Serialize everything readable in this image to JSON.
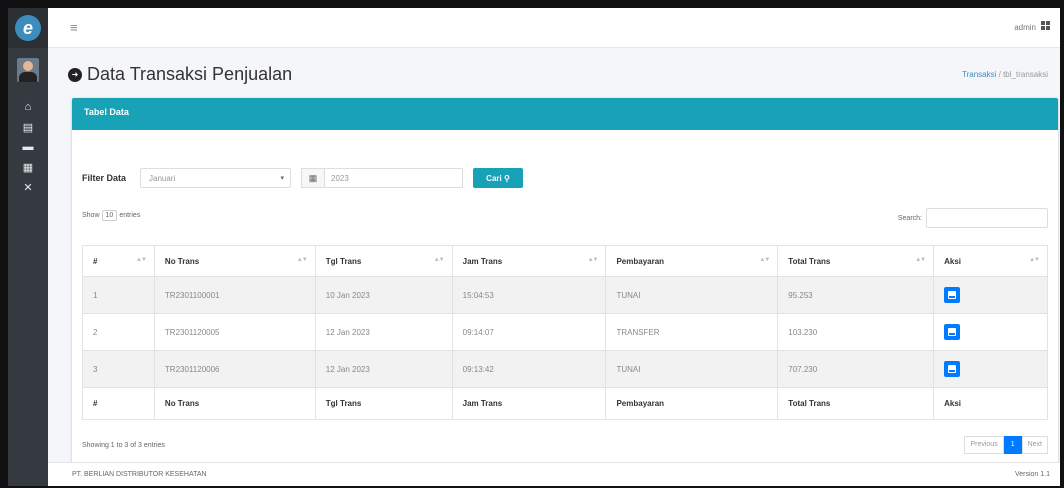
{
  "sidebar": {
    "logo_letter": "e",
    "icons": [
      "home-icon",
      "book-icon",
      "wallet-icon",
      "calculator-icon",
      "tools-icon"
    ],
    "icon_glyphs": [
      "⌂",
      "▤",
      "▬",
      "▦",
      "✕"
    ]
  },
  "topbar": {
    "menu_glyph": "≡",
    "user": "admin"
  },
  "page": {
    "title": "Data Transaksi Penjualan",
    "breadcrumb_link": "Transaksi",
    "breadcrumb_sep": "/",
    "breadcrumb_current": "tbl_transaksi"
  },
  "card": {
    "header": "Tabel Data",
    "filter_label": "Filter Data",
    "month_value": "Januari",
    "year_value": "2023",
    "search_button": "Cari",
    "show_prefix": "Show",
    "show_value": "10",
    "show_suffix": "entries",
    "search_label": "Search:"
  },
  "table": {
    "columns": [
      "#",
      "No Trans",
      "Tgl Trans",
      "Jam Trans",
      "Pembayaran",
      "Total Trans",
      "Aksi"
    ],
    "rows": [
      [
        "1",
        "TR2301100001",
        "10 Jan 2023",
        "15:04:53",
        "TUNAI",
        "95.253"
      ],
      [
        "2",
        "TR2301120005",
        "12 Jan 2023",
        "09:14:07",
        "TRANSFER",
        "103.230"
      ],
      [
        "3",
        "TR2301120006",
        "12 Jan 2023",
        "09:13:42",
        "TUNAI",
        "707.230"
      ]
    ],
    "footer": [
      "#",
      "No Trans",
      "Tgl Trans",
      "Jam Trans",
      "Pembayaran",
      "Total Trans",
      "Aksi"
    ]
  },
  "info": "Showing 1 to 3 of 3 entries",
  "pagination": {
    "previous": "Previous",
    "page": "1",
    "next": "Next"
  },
  "footer": {
    "company": "PT. BERLIAN DISTRIBUTOR KESEHATAN",
    "version": "Version 1.1"
  },
  "colors": {
    "sidebar": "#343a40",
    "card_header": "#17a2b8",
    "primary": "#007bff"
  }
}
